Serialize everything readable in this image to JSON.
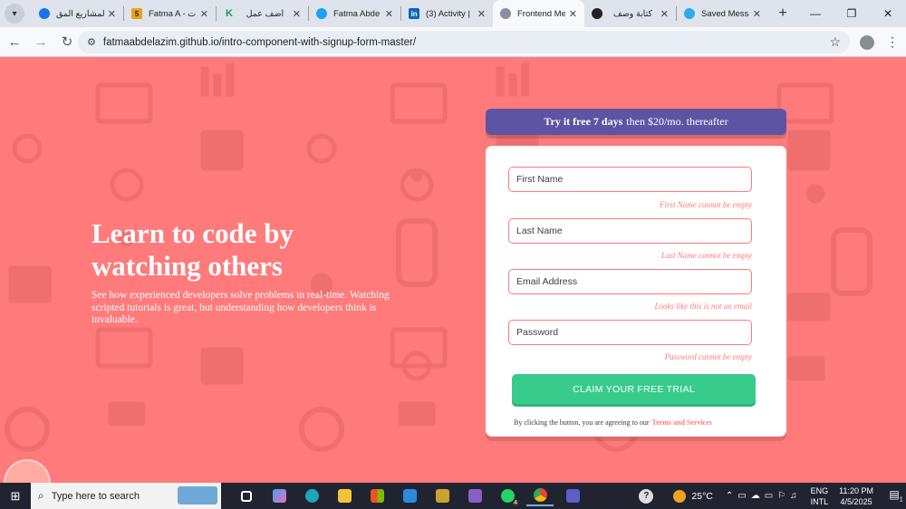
{
  "browser": {
    "tabs": [
      {
        "label": "المشاريع المق",
        "fav_color": "#1a73e8",
        "fav_glyph": ""
      },
      {
        "label": "Fatma A - ت",
        "fav_color": "#e8a317",
        "fav_glyph": "5"
      },
      {
        "label": "أضف عمل",
        "fav_color": "#15a04a",
        "fav_glyph": "K"
      },
      {
        "label": "Fatma Abde",
        "fav_color": "#1da1f2",
        "fav_glyph": ""
      },
      {
        "label": "(3) Activity |",
        "fav_color": "#0a66c2",
        "fav_glyph": "in"
      },
      {
        "label": "Frontend Me",
        "fav_color": "#8a8fa8",
        "fav_glyph": ""
      },
      {
        "label": "كتابة وصف",
        "fav_color": "#222222",
        "fav_glyph": ""
      },
      {
        "label": "Saved Messa",
        "fav_color": "#2aabee",
        "fav_glyph": ""
      }
    ],
    "active_tab_index": 5,
    "url": "fatmaabdelazim.github.io/intro-component-with-signup-form-master/"
  },
  "hero": {
    "title_line1": "Learn to code by",
    "title_line2": "watching others",
    "description": "See how experienced developers solve problems in real-time. Watching scripted tutorials is great, but understanding how developers think is invaluable."
  },
  "trial": {
    "bold": "Try it free 7 days",
    "rest": "then $20/mo. thereafter"
  },
  "form": {
    "fields": [
      {
        "placeholder": "First Name",
        "error": "First Name cannot be empty"
      },
      {
        "placeholder": "Last Name",
        "error": "Last Name cannot be empty"
      },
      {
        "placeholder": "Email Address",
        "error": "Looks like this is not an email"
      },
      {
        "placeholder": "Password",
        "error": "Password cannot be empty"
      }
    ],
    "submit_label": "CLAIM YOUR FREE TRIAL",
    "terms_text": "By clicking the button, you are agreeing to our",
    "terms_link": "Terms and Services"
  },
  "taskbar": {
    "search_placeholder": "Type here to search",
    "weather": "25°C",
    "lang_line1": "ENG",
    "lang_line2": "INTL",
    "time": "11:20 PM",
    "date": "4/5/2025",
    "whatsapp_badge": "4",
    "notification_count": "1"
  },
  "colors": {
    "background": "#ff7a7a",
    "trial_banner": "#5e54a4",
    "submit": "#38cc8c",
    "error": "#ff7a7a"
  }
}
